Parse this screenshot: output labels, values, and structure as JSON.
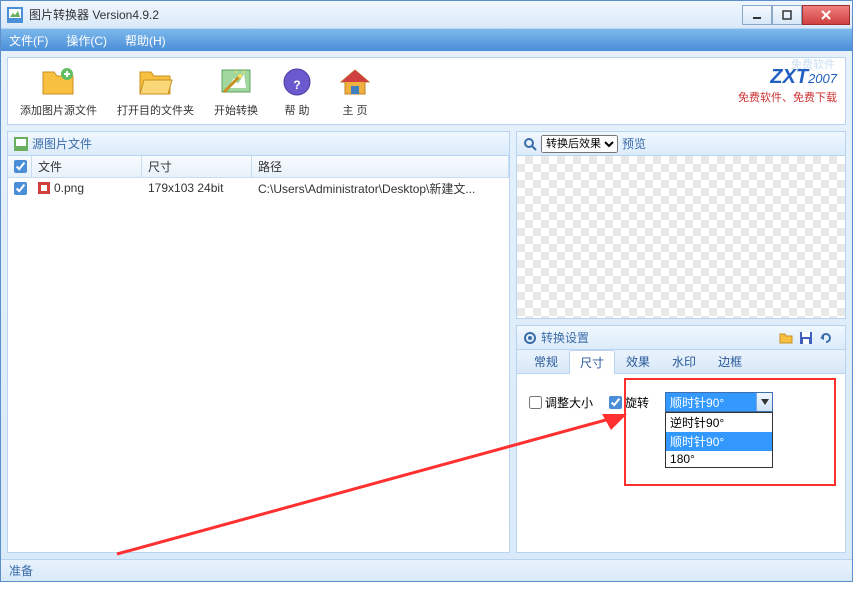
{
  "title": "图片转换器 Version4.9.2",
  "menu": {
    "file": "文件(F)",
    "operate": "操作(C)",
    "help": "帮助(H)"
  },
  "toolbar": {
    "add_source": "添加图片源文件",
    "open_target": "打开目的文件夹",
    "start_convert": "开始转换",
    "help": "帮 助",
    "home": "主 页",
    "free_sw": "免费软件",
    "brand": "ZXT",
    "brand_year": "2007",
    "tagline": "免费软件、免费下载"
  },
  "source_pane": {
    "title": "源图片文件",
    "col_file": "文件",
    "col_size": "尺寸",
    "col_path": "路径",
    "rows": [
      {
        "file": "0.png",
        "size": "179x103  24bit",
        "path": "C:\\Users\\Administrator\\Desktop\\新建文..."
      }
    ]
  },
  "preview": {
    "select_label": "转换后效果",
    "preview_label": "预览"
  },
  "settings": {
    "title": "转换设置",
    "tabs": {
      "general": "常规",
      "size": "尺寸",
      "effect": "效果",
      "watermark": "水印",
      "border": "边框"
    },
    "resize": "调整大小",
    "rotate": "旋转",
    "rotate_options": {
      "ccw90": "逆时针90°",
      "cw90": "顺时针90°",
      "r180": "180°"
    },
    "rotate_selected": "顺时针90°"
  },
  "status": "准备"
}
